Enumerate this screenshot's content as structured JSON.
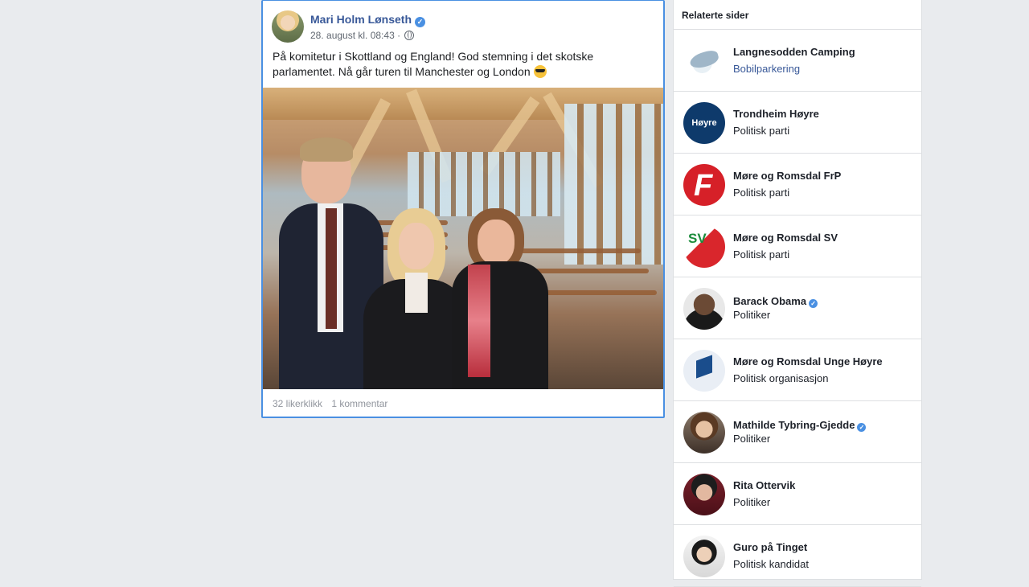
{
  "post": {
    "author": "Mari Holm Lønseth",
    "timestamp": "28. august kl. 08:43 ·",
    "text": "På komitetur i Skottland og England! God stemning i det skotske parlamentet. Nå går turen til Manchester og London",
    "likes": "32 likerklikk",
    "comments": "1 kommentar"
  },
  "related": {
    "title": "Relaterte sider",
    "items": [
      {
        "name": "Langnesodden Camping",
        "category": "Bobilparkering",
        "icon": "dolphin-logo"
      },
      {
        "name": "Trondheim Høyre",
        "category": "Politisk parti",
        "icon": "hoyre-logo",
        "logo_text": "Høyre"
      },
      {
        "name": "Møre og Romsdal FrP",
        "category": "Politisk parti",
        "icon": "frp-apple-logo"
      },
      {
        "name": "Møre og Romsdal SV",
        "category": "Politisk parti",
        "icon": "sv-logo"
      },
      {
        "name": "Barack Obama",
        "category": "Politiker",
        "icon": "profile-photo"
      },
      {
        "name": "Møre og Romsdal Unge Høyre",
        "category": "Politisk organisasjon",
        "icon": "unge-hoyre-logo"
      },
      {
        "name": "Mathilde Tybring-Gjedde",
        "category": "Politiker",
        "icon": "profile-photo"
      },
      {
        "name": "Rita Ottervik",
        "category": "Politiker",
        "icon": "profile-photo"
      },
      {
        "name": "Guro på Tinget",
        "category": "Politisk kandidat",
        "icon": "profile-photo"
      }
    ]
  }
}
